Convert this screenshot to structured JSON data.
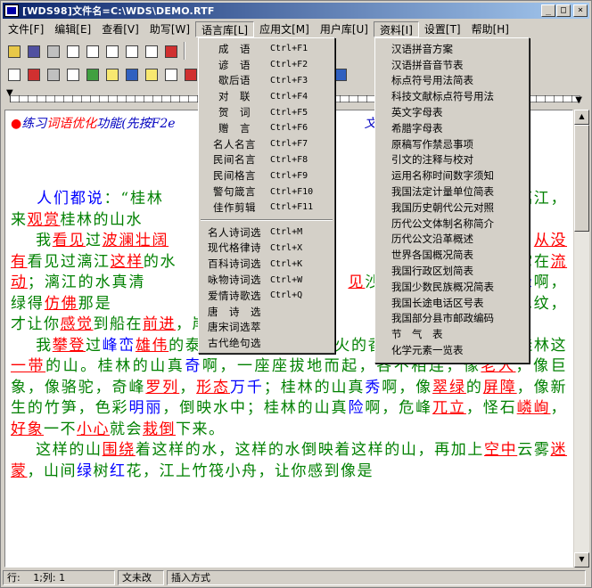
{
  "window": {
    "title": "[WDS98]文件名=C:\\WDS\\DEMO.RTF",
    "minimize": "_",
    "maximize": "□",
    "close": "×"
  },
  "menubar": [
    {
      "label": "文件[F]"
    },
    {
      "label": "编辑[E]"
    },
    {
      "label": "查看[V]"
    },
    {
      "label": "助写[W]"
    },
    {
      "label": "语言库[L]"
    },
    {
      "label": "应用文[M]"
    },
    {
      "label": "用户库[U]"
    },
    {
      "label": "资料[I]"
    },
    {
      "label": "设置[T]"
    },
    {
      "label": "帮助[H]"
    }
  ],
  "ruler": {
    "left_marker": "▼",
    "right_marker": "▼"
  },
  "document": {
    "prompt_dot": "●",
    "prompt_a": "练习",
    "prompt_red": "词语优化",
    "prompt_b": "功能(先按F2e",
    "prompt_c": "文章中",
    "title_visible": "水",
    "paragraphs": [
      [
        {
          "t": "    "
        },
        {
          "t": "人们",
          "c": "blue"
        },
        {
          "t": "都",
          "c": "blue"
        },
        {
          "t": "说",
          "c": "blue"
        },
        {
          "t": "：“桂林"
        },
        {
          "t": "　　　　　　　　　　　　　"
        },
        {
          "t": "我",
          "c": "red"
        },
        {
          "t": "们"
        },
        {
          "t": "　　　　　　"
        },
        {
          "t": "漓"
        },
        {
          "t": "江，来"
        },
        {
          "t": "观赏",
          "c": "red"
        },
        {
          "t": "桂林的山水"
        }
      ],
      [
        {
          "t": "    我"
        },
        {
          "t": "看见",
          "c": "red"
        },
        {
          "t": "过"
        },
        {
          "t": "波澜壮阔",
          "c": "red"
        },
        {
          "t": "　　　　　　　　　　　　　　　"
        },
        {
          "t": "水平"
        },
        {
          "t": "　　　　　"
        },
        {
          "t": "从没",
          "c": "red"
        },
        {
          "t": "有",
          "c": "red"
        },
        {
          "t": "看见过漓江"
        },
        {
          "t": "这样",
          "c": "red"
        },
        {
          "t": "的水"
        },
        {
          "t": "　　　　　　　　　　　　　"
        },
        {
          "t": "啊，"
        },
        {
          "t": "　　　　　"
        },
        {
          "t": "到它"
        },
        {
          "t": "在"
        },
        {
          "t": "流动",
          "c": "red"
        },
        {
          "t": "；漓江的水真清"
        },
        {
          "t": "　　　　　　　　　　　　"
        },
        {
          "t": "见",
          "c": "red"
        },
        {
          "t": "沙"
        },
        {
          "t": "　　　　　　"
        },
        {
          "t": "水"
        },
        {
          "t": "真"
        },
        {
          "t": "绿",
          "c": "blue"
        },
        {
          "t": "啊，绿得"
        },
        {
          "t": "仿佛",
          "c": "red"
        },
        {
          "t": "那是"
        },
        {
          "t": "　　　　　　　　　　　"
        },
        {
          "t": "。舰"
        },
        {
          "t": "　　　　　"
        },
        {
          "t": "扩散",
          "c": "red"
        },
        {
          "t": "出一道道水纹，才让你"
        },
        {
          "t": "感觉",
          "c": "red"
        },
        {
          "t": "到船在"
        },
        {
          "t": "前进",
          "c": "red"
        },
        {
          "t": "，岸在后移。"
        }
      ],
      [
        {
          "t": "    我"
        },
        {
          "t": "攀登",
          "c": "red"
        },
        {
          "t": "过"
        },
        {
          "t": "峰峦",
          "c": "blue"
        },
        {
          "t": "雄伟",
          "c": "red"
        },
        {
          "t": "的泰山，"
        },
        {
          "t": "游览",
          "c": "red"
        },
        {
          "t": "过红叶"
        },
        {
          "t": "似",
          "c": "blue"
        },
        {
          "t": "火的香山，却从没"
        },
        {
          "t": "看见过桂林这"
        },
        {
          "t": "一带",
          "c": "red"
        },
        {
          "t": "的山。桂林的山真"
        },
        {
          "t": "奇",
          "c": "blue"
        },
        {
          "t": "啊，一座座拔地而起，各"
        },
        {
          "t": "不相连，像"
        },
        {
          "t": "老人",
          "c": "red"
        },
        {
          "t": "，像巨象，像骆驼，奇峰"
        },
        {
          "t": "罗列",
          "c": "red"
        },
        {
          "t": "，"
        },
        {
          "t": "形态",
          "c": "red"
        },
        {
          "t": "万千",
          "c": "blue"
        },
        {
          "t": "；桂林"
        },
        {
          "t": "的山真"
        },
        {
          "t": "秀",
          "c": "blue"
        },
        {
          "t": "啊，像"
        },
        {
          "t": "翠绿",
          "c": "red"
        },
        {
          "t": "的"
        },
        {
          "t": "屏障",
          "c": "red"
        },
        {
          "t": "，像新生的竹笋，色彩"
        },
        {
          "t": "明丽",
          "c": "blue"
        },
        {
          "t": "，倒映水"
        },
        {
          "t": "中；桂林的山真"
        },
        {
          "t": "险",
          "c": "blue"
        },
        {
          "t": "啊，危峰"
        },
        {
          "t": "兀立",
          "c": "red"
        },
        {
          "t": "，怪石"
        },
        {
          "t": "嶙峋",
          "c": "red"
        },
        {
          "t": "，"
        },
        {
          "t": "好象",
          "c": "red"
        },
        {
          "t": "一不"
        },
        {
          "t": "小心",
          "c": "red"
        },
        {
          "t": "就会"
        },
        {
          "t": "栽倒",
          "c": "red"
        },
        {
          "t": "下来。"
        }
      ],
      [
        {
          "t": "    这样的山"
        },
        {
          "t": "围绕",
          "c": "red"
        },
        {
          "t": "着这样的水，这样的水倒映着这样的山，再加"
        },
        {
          "t": "上"
        },
        {
          "t": "空中",
          "c": "red"
        },
        {
          "t": "云雾"
        },
        {
          "t": "迷蒙",
          "c": "red"
        },
        {
          "t": "，山间"
        },
        {
          "t": "绿",
          "c": "blue"
        },
        {
          "t": "树"
        },
        {
          "t": "红",
          "c": "blue"
        },
        {
          "t": "花，江上竹筏小舟，让你感到像是"
        }
      ]
    ]
  },
  "lang_menu": {
    "items_a": [
      {
        "label": "成　语",
        "shortcut": "Ctrl+F1"
      },
      {
        "label": "谚　语",
        "shortcut": "Ctrl+F2"
      },
      {
        "label": "歇后语",
        "shortcut": "Ctrl+F3"
      },
      {
        "label": "对　联",
        "shortcut": "Ctrl+F4"
      },
      {
        "label": "贺　词",
        "shortcut": "Ctrl+F5"
      },
      {
        "label": "赠　言",
        "shortcut": "Ctrl+F6"
      },
      {
        "label": "名人名言",
        "shortcut": "Ctrl+F7"
      },
      {
        "label": "民间名言",
        "shortcut": "Ctrl+F8"
      },
      {
        "label": "民间格言",
        "shortcut": "Ctrl+F9"
      },
      {
        "label": "警句箴言",
        "shortcut": "Ctrl+F10"
      },
      {
        "label": "佳作剪辑",
        "shortcut": "Ctrl+F11"
      }
    ],
    "items_b": [
      {
        "label": "名人诗词选",
        "shortcut": "Ctrl+M"
      },
      {
        "label": "现代格律诗",
        "shortcut": "Ctrl+X"
      },
      {
        "label": "百科诗词选",
        "shortcut": "Ctrl+K"
      },
      {
        "label": "咏物诗词选",
        "shortcut": "Ctrl+W"
      },
      {
        "label": "爱情诗歌选",
        "shortcut": "Ctrl+Q"
      },
      {
        "label": "唐　诗　选",
        "shortcut": ""
      },
      {
        "label": "唐宋词选萃",
        "shortcut": ""
      },
      {
        "label": "古代绝句选",
        "shortcut": ""
      }
    ]
  },
  "ref_menu": [
    "汉语拼音方案",
    "汉语拼音音节表",
    "标点符号用法简表",
    "科技文献标点符号用法",
    "英文字母表",
    "希腊字母表",
    "原稿写作禁忌事项",
    "引文的注释与校对",
    "运用名称时间数字须知",
    "我国法定计量单位简表",
    "我国历史朝代公元对照",
    "历代公文体制名称简介",
    "历代公文沿革概述",
    "世界各国概况简表",
    "我国行政区划简表",
    "我国少数民族概况简表",
    "我国长途电话区号表",
    "我国部分县市邮政编码",
    "节　气　表",
    "化学元素一览表"
  ],
  "statusbar": {
    "position": "行:　 1;列:  1",
    "mode": "文未改",
    "insert": "插入方式"
  },
  "colors": {
    "red": "#ff0000",
    "blue": "#0000ff",
    "green": "#008000",
    "title_green": "#00c000"
  }
}
